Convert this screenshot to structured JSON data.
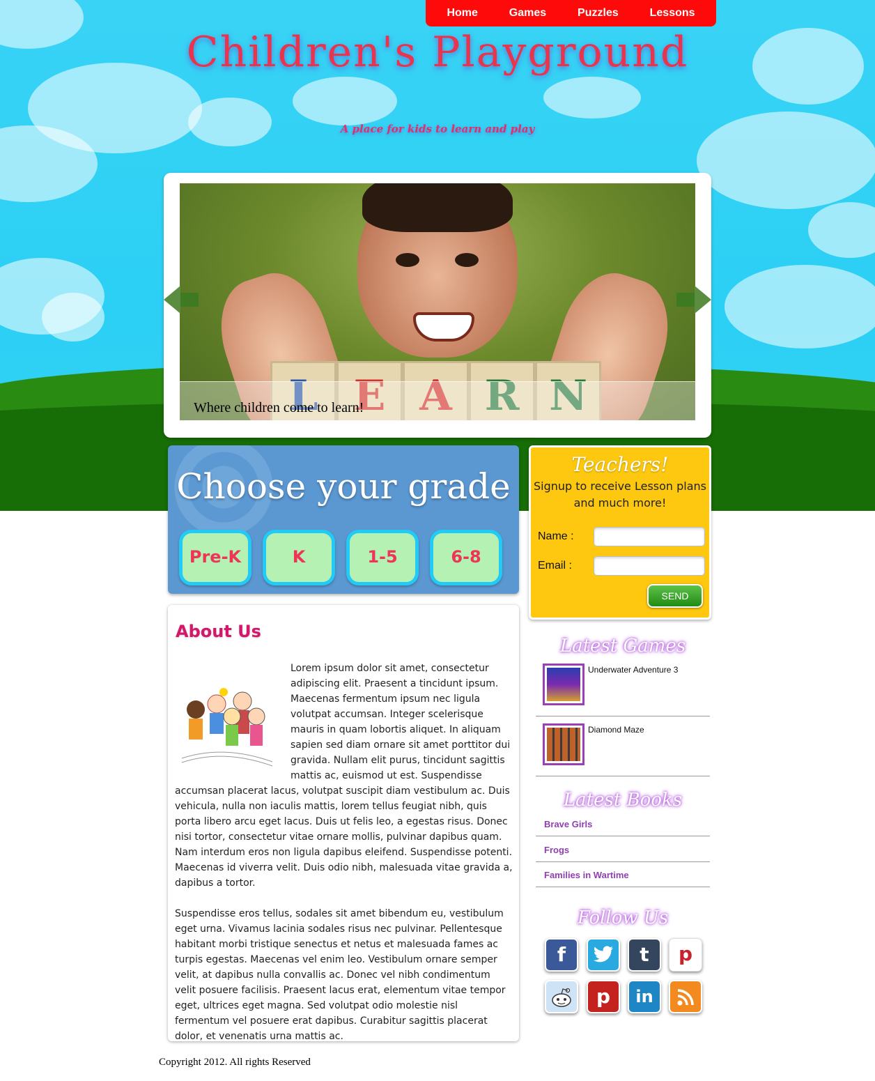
{
  "nav": {
    "items": [
      "Home",
      "Games",
      "Puzzles",
      "Lessons"
    ]
  },
  "site": {
    "title": "Children's Playground",
    "tagline": "A place for kids to learn and play"
  },
  "slider": {
    "caption": "Where children come to learn!",
    "blocks": [
      "L",
      "E",
      "A",
      "R",
      "N"
    ]
  },
  "grades": {
    "title": "Choose your grade",
    "buttons": [
      "Pre-K",
      "K",
      "1-5",
      "6-8"
    ]
  },
  "teachers": {
    "heading": "Teachers!",
    "subheading": "Signup to receive Lesson plans and much more!",
    "name_label": "Name :",
    "email_label": "Email :",
    "send_label": "SEND"
  },
  "about": {
    "heading": "About Us",
    "paragraphs": [
      "Lorem ipsum dolor sit amet, consectetur adipiscing elit. Praesent a tincidunt ipsum. Maecenas fermentum ipsum nec ligula volutpat accumsan. Integer scelerisque mauris in quam lobortis aliquet. In aliquam sapien sed diam ornare sit amet porttitor dui gravida. Nullam elit purus, tincidunt sagittis mattis ac, euismod ut est. Suspendisse accumsan placerat lacus, volutpat suscipit diam vestibulum ac. Duis vehicula, nulla non iaculis mattis, lorem tellus feugiat nibh, quis porta libero arcu eget lacus. Duis ut felis leo, a egestas risus. Donec nisi tortor, consectetur vitae ornare mollis, pulvinar dapibus quam. Nam interdum eros non ligula dapibus eleifend. Suspendisse potenti. Maecenas id viverra velit. Duis odio nibh, malesuada vitae gravida a, dapibus a tortor.",
      "Suspendisse eros tellus, sodales sit amet bibendum eu, vestibulum eget urna. Vivamus lacinia sodales risus nec pulvinar. Pellentesque habitant morbi tristique senectus et netus et malesuada fames ac turpis egestas. Maecenas vel enim leo. Vestibulum ornare semper velit, at dapibus nulla convallis ac. Donec vel nibh condimentum velit posuere facilisis. Praesent lacus erat, elementum vitae tempor eget, ultrices eget magna. Sed volutpat odio molestie nisl fermentum vel posuere erat dapibus. Curabitur sagittis placerat dolor, et venenatis urna mattis ac."
    ]
  },
  "latest_games": {
    "title": "Latest Games",
    "items": [
      {
        "name": "Underwater Adventure 3"
      },
      {
        "name": "Diamond Maze"
      }
    ]
  },
  "latest_books": {
    "title": "Latest Books",
    "items": [
      "Brave Girls",
      "Frogs",
      "Families in Wartime"
    ]
  },
  "follow": {
    "title": "Follow Us",
    "icons": [
      {
        "name": "facebook-icon",
        "glyph": "f",
        "color": "#3b5998"
      },
      {
        "name": "twitter-icon",
        "glyph": "t",
        "color": "#28a9e0"
      },
      {
        "name": "tumblr-icon",
        "glyph": "t",
        "color": "#34465d"
      },
      {
        "name": "pinterest-icon",
        "glyph": "p",
        "color": "#ffffff"
      },
      {
        "name": "reddit-icon",
        "glyph": "r",
        "color": "#cfe3f7"
      },
      {
        "name": "pinterest-icon",
        "glyph": "p",
        "color": "#c3221f"
      },
      {
        "name": "linkedin-icon",
        "glyph": "in",
        "color": "#1f86c5"
      },
      {
        "name": "rss-icon",
        "glyph": "rss",
        "color": "#f28a1f"
      }
    ]
  },
  "footer": {
    "copyright": "Copyright 2012. All rights Reserved"
  }
}
